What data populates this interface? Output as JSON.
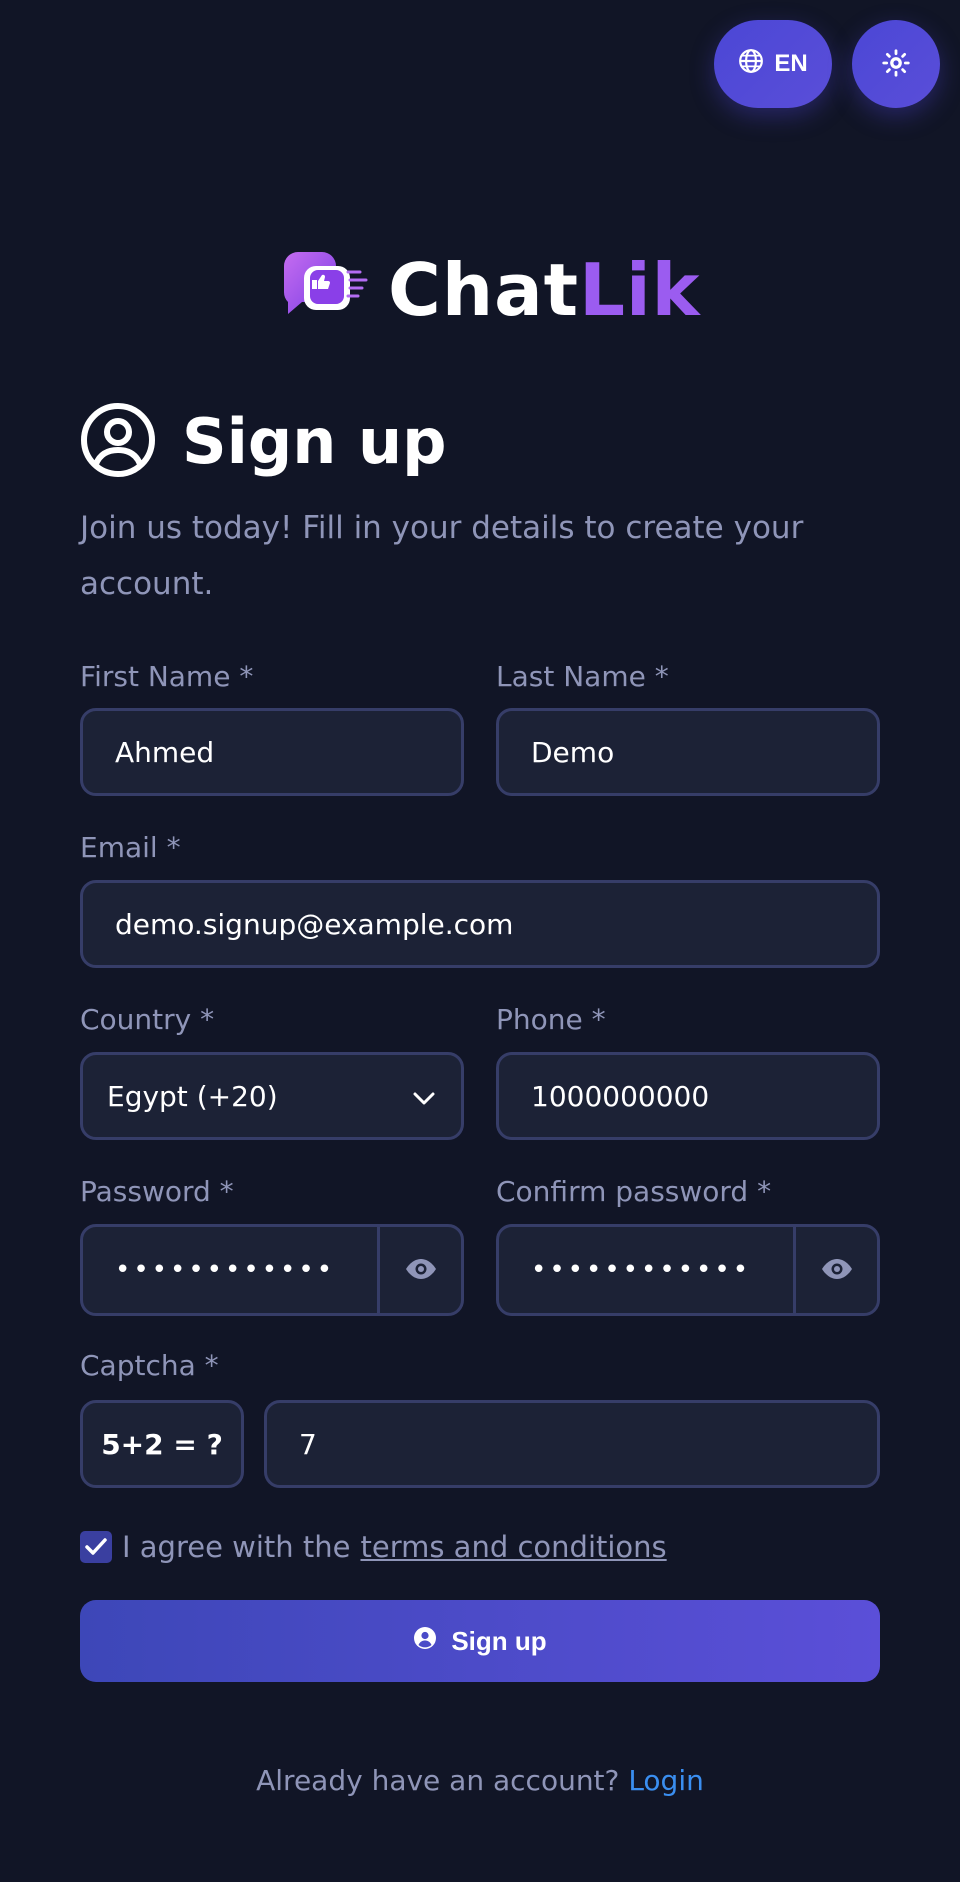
{
  "top_controls": {
    "language": "EN"
  },
  "brand": {
    "name_part1": "Chat",
    "name_part2": "Lik"
  },
  "header": {
    "title": "Sign up",
    "subtitle": "Join us today! Fill in your details to create your account."
  },
  "form": {
    "first_name": {
      "label": "First Name *",
      "value": "Ahmed"
    },
    "last_name": {
      "label": "Last Name *",
      "value": "Demo"
    },
    "email": {
      "label": "Email *",
      "value": "demo.signup@example.com"
    },
    "country": {
      "label": "Country *",
      "value": "Egypt (+20)"
    },
    "phone": {
      "label": "Phone *",
      "value": "1000000000"
    },
    "password": {
      "label": "Password *",
      "masked": "••••••••••••"
    },
    "confirm_password": {
      "label": "Confirm password *",
      "masked": "••••••••••••"
    },
    "captcha": {
      "label": "Captcha *",
      "question": "5+2 = ?",
      "value": "7"
    },
    "agree": {
      "prefix": "I agree with the",
      "link": "terms and conditions",
      "checked": true
    },
    "submit_label": "Sign up"
  },
  "footer": {
    "prompt": "Already have an account?",
    "link": "Login"
  },
  "colors": {
    "background": "#111526",
    "accent": "#5a4ed8",
    "brand_purple": "#9b5cf0",
    "link": "#3a8ef0"
  }
}
